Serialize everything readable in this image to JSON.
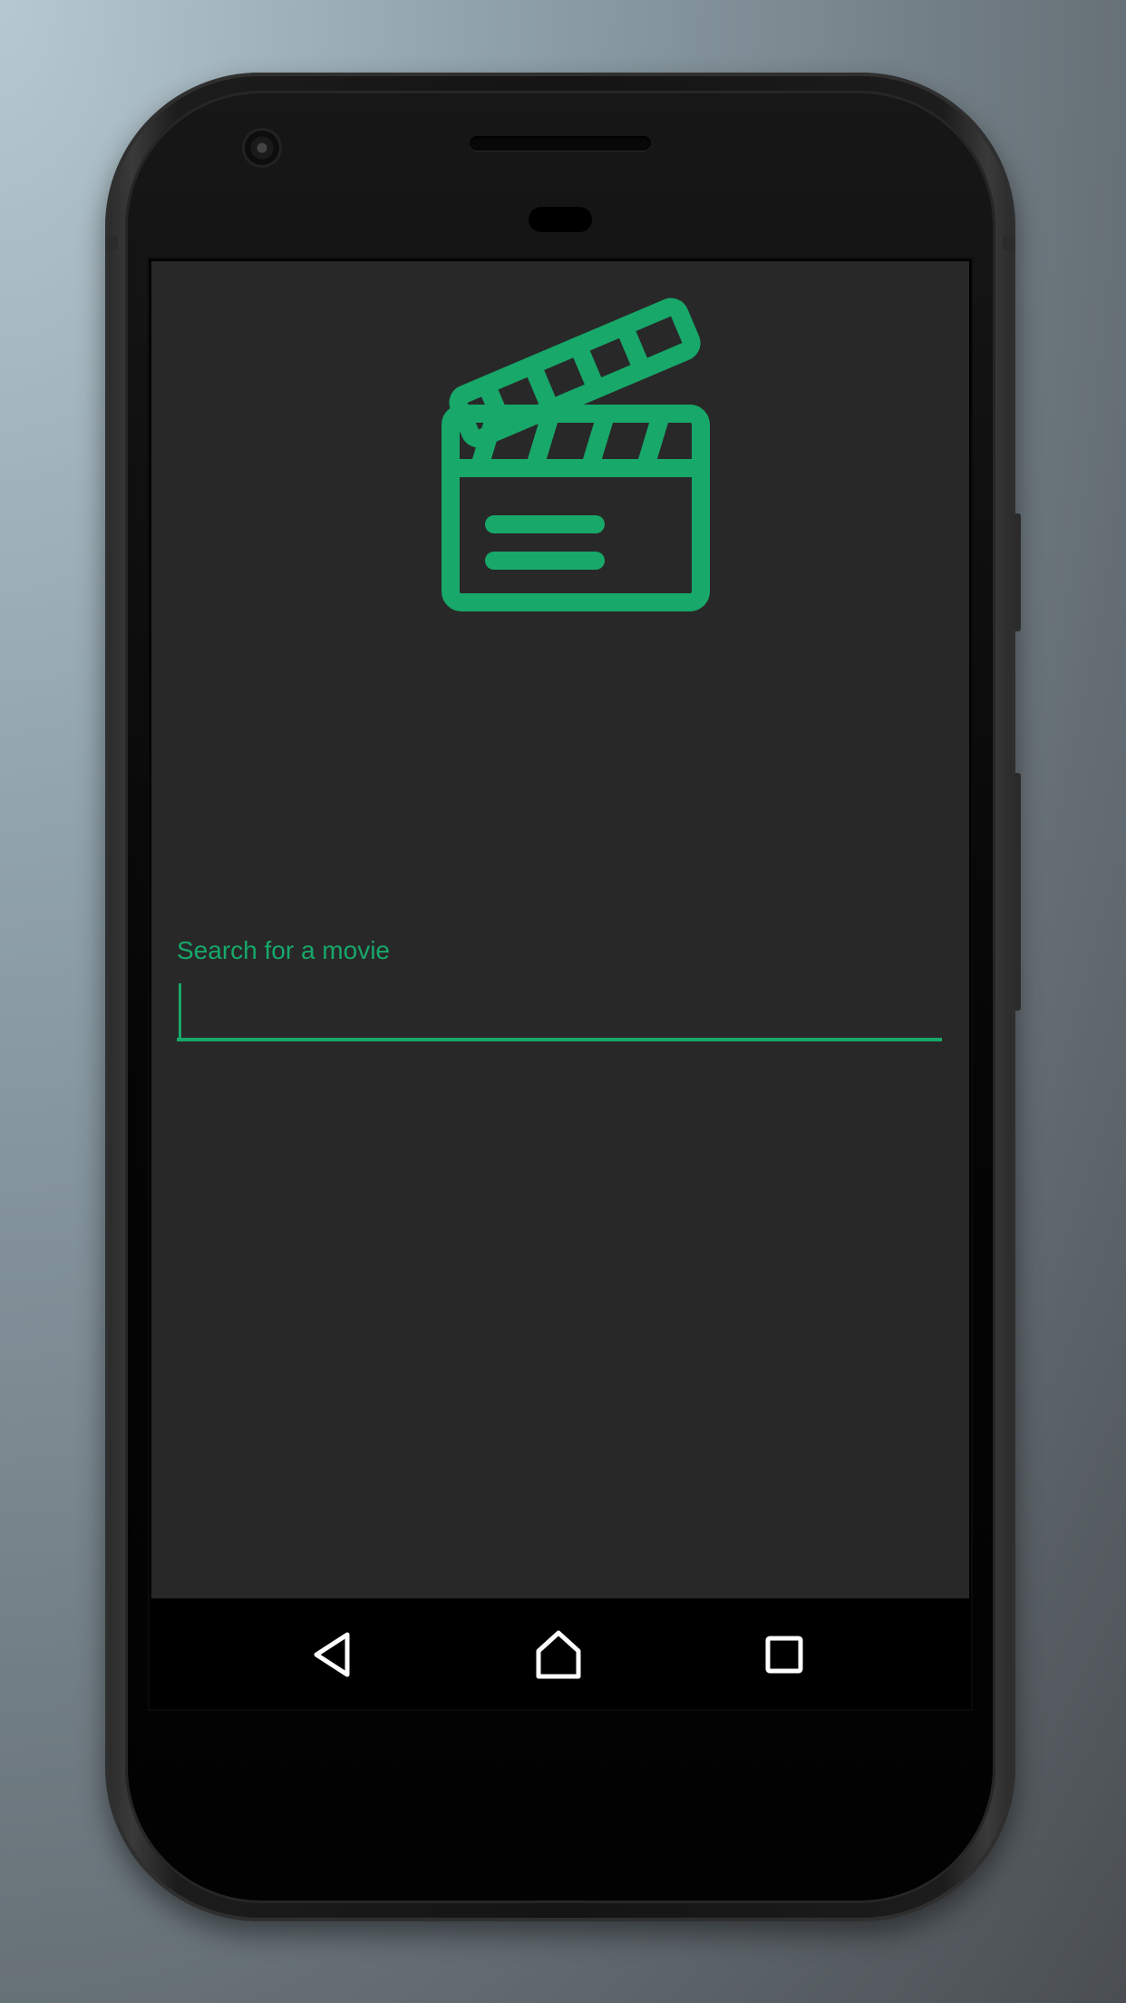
{
  "device": {
    "frame": "android-phone"
  },
  "app": {
    "logo_icon": "clapperboard-icon",
    "accent_color": "#17a86a",
    "background_color": "#282828"
  },
  "search": {
    "label": "Search for a movie",
    "value": "",
    "placeholder": ""
  },
  "navbar": {
    "back_icon": "back-triangle-icon",
    "home_icon": "home-icon",
    "recents_icon": "recents-square-icon"
  }
}
